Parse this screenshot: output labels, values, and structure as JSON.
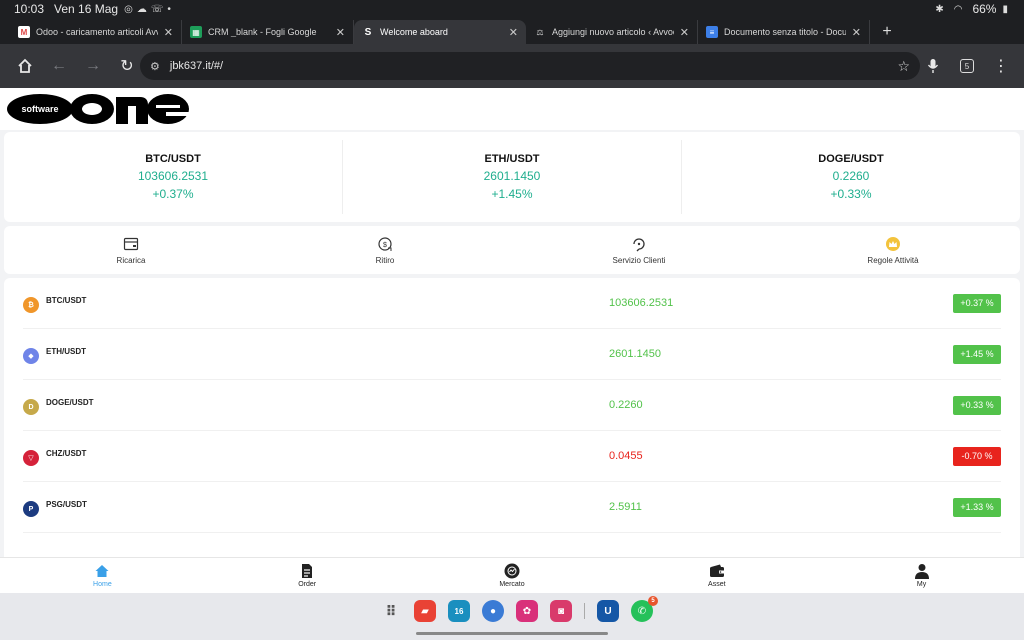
{
  "status_bar": {
    "time": "10:03",
    "date": "Ven 16 Mag",
    "battery": "66%"
  },
  "tabs": [
    {
      "title": "Odoo - caricamento articoli Avvocato",
      "favicon": "gmail-icon",
      "active": false
    },
    {
      "title": "CRM _blank - Fogli Google",
      "favicon": "sheets-icon",
      "active": false
    },
    {
      "title": "Welcome aboard",
      "favicon": "s-icon",
      "active": true
    },
    {
      "title": "Aggiungi nuovo articolo ‹ Avvocato",
      "favicon": "wp-icon",
      "active": false
    },
    {
      "title": "Documento senza titolo - Documenti",
      "favicon": "docs-icon",
      "active": false
    }
  ],
  "toolbar": {
    "url": "jbk637.it/#/",
    "tab_count": "5"
  },
  "logo": {
    "small": "software",
    "big": "one"
  },
  "tickers": [
    {
      "pair": "BTC/USDT",
      "price": "103606.2531",
      "change": "+0.37%"
    },
    {
      "pair": "ETH/USDT",
      "price": "2601.1450",
      "change": "+1.45%"
    },
    {
      "pair": "DOGE/USDT",
      "price": "0.2260",
      "change": "+0.33%"
    }
  ],
  "actions": [
    {
      "label": "Ricarica",
      "icon": "wallet-card-icon"
    },
    {
      "label": "Ritiro",
      "icon": "withdraw-icon"
    },
    {
      "label": "Servizio Clienti",
      "icon": "support-icon"
    },
    {
      "label": "Regole Attività",
      "icon": "crown-icon"
    }
  ],
  "market": [
    {
      "pair": "BTC/USDT",
      "price": "103606.2531",
      "change": "+0.37 %",
      "direction": "up",
      "coin_color": "#f0962a",
      "coin_glyph": "₿"
    },
    {
      "pair": "ETH/USDT",
      "price": "2601.1450",
      "change": "+1.45 %",
      "direction": "up",
      "coin_color": "#6f84e8",
      "coin_glyph": "◆"
    },
    {
      "pair": "DOGE/USDT",
      "price": "0.2260",
      "change": "+0.33 %",
      "direction": "up",
      "coin_color": "#c6a94a",
      "coin_glyph": "D"
    },
    {
      "pair": "CHZ/USDT",
      "price": "0.0455",
      "change": "-0.70 %",
      "direction": "down",
      "coin_color": "#d5223a",
      "coin_glyph": "▽"
    },
    {
      "pair": "PSG/USDT",
      "price": "2.5911",
      "change": "+1.33 %",
      "direction": "up",
      "coin_color": "#1c3b80",
      "coin_glyph": "P"
    }
  ],
  "colors": {
    "up": "#52c24a",
    "down": "#e8241d",
    "ticker_green": "#1fae8e",
    "nav_active": "#3aa0e8"
  },
  "bottom_nav": [
    {
      "label": "Home",
      "icon": "home-icon",
      "active": true
    },
    {
      "label": "Order",
      "icon": "order-icon",
      "active": false
    },
    {
      "label": "Mercato",
      "icon": "market-icon",
      "active": false
    },
    {
      "label": "Asset",
      "icon": "wallet-icon",
      "active": false
    },
    {
      "label": "My",
      "icon": "user-icon",
      "active": false
    }
  ],
  "dock": {
    "calendar_day": "16",
    "whatsapp_badge": "5"
  }
}
